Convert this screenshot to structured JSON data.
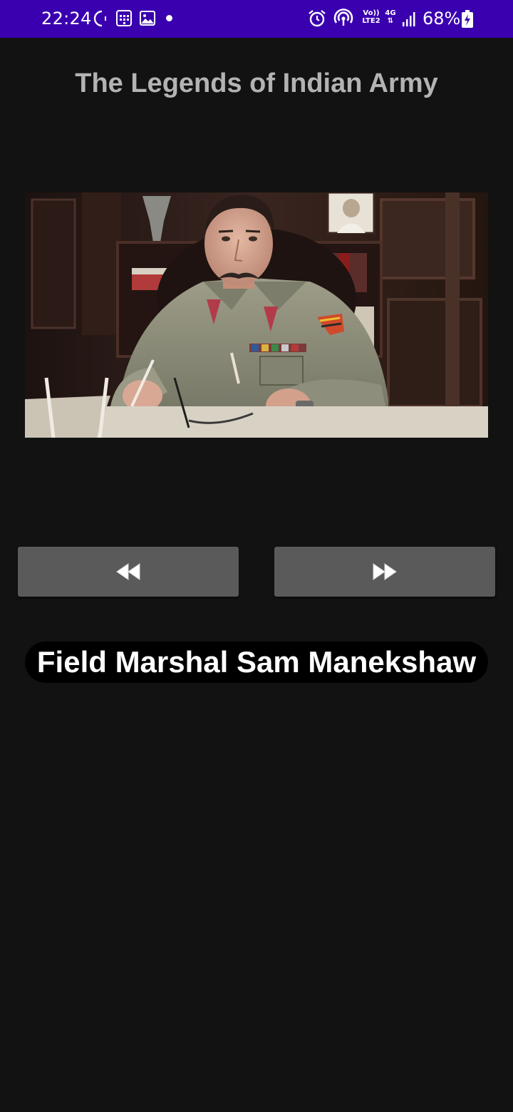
{
  "status_bar": {
    "time": "22:24",
    "network_volte_line1": "Vo))",
    "network_volte_line2": "LTE2",
    "network_type": "4G",
    "battery_percent": "68%",
    "icons": [
      "moon-icon",
      "calendar-icon",
      "gallery-icon",
      "notification-dot-icon",
      "alarm-icon",
      "hotspot-icon",
      "signal-icon",
      "battery-icon"
    ],
    "background_color": "#3a00b0"
  },
  "header": {
    "title": "The Legends of Indian Army"
  },
  "photo": {
    "subject": "Field Marshal Sam Manekshaw"
  },
  "navigation": {
    "previous_icon": "rewind-icon",
    "next_icon": "fast-forward-icon"
  },
  "caption": {
    "name": "Field Marshal Sam Manekshaw"
  },
  "colors": {
    "background": "#121212",
    "button": "#5a5a5a",
    "title_text": "#b3b3b3",
    "caption_background": "#000000"
  }
}
